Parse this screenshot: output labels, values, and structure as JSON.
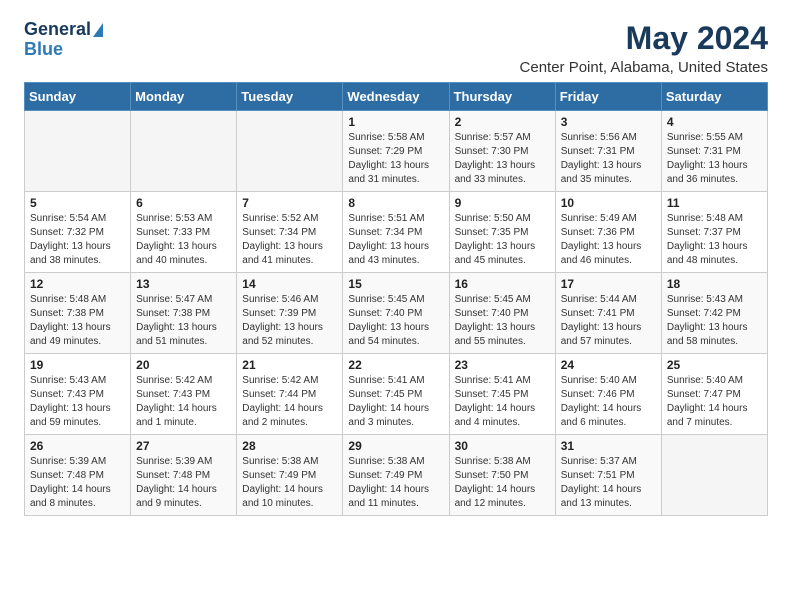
{
  "logo": {
    "general": "General",
    "blue": "Blue"
  },
  "title": "May 2024",
  "subtitle": "Center Point, Alabama, United States",
  "weekdays": [
    "Sunday",
    "Monday",
    "Tuesday",
    "Wednesday",
    "Thursday",
    "Friday",
    "Saturday"
  ],
  "weeks": [
    [
      {
        "day": "",
        "info": ""
      },
      {
        "day": "",
        "info": ""
      },
      {
        "day": "",
        "info": ""
      },
      {
        "day": "1",
        "info": "Sunrise: 5:58 AM\nSunset: 7:29 PM\nDaylight: 13 hours and 31 minutes."
      },
      {
        "day": "2",
        "info": "Sunrise: 5:57 AM\nSunset: 7:30 PM\nDaylight: 13 hours and 33 minutes."
      },
      {
        "day": "3",
        "info": "Sunrise: 5:56 AM\nSunset: 7:31 PM\nDaylight: 13 hours and 35 minutes."
      },
      {
        "day": "4",
        "info": "Sunrise: 5:55 AM\nSunset: 7:31 PM\nDaylight: 13 hours and 36 minutes."
      }
    ],
    [
      {
        "day": "5",
        "info": "Sunrise: 5:54 AM\nSunset: 7:32 PM\nDaylight: 13 hours and 38 minutes."
      },
      {
        "day": "6",
        "info": "Sunrise: 5:53 AM\nSunset: 7:33 PM\nDaylight: 13 hours and 40 minutes."
      },
      {
        "day": "7",
        "info": "Sunrise: 5:52 AM\nSunset: 7:34 PM\nDaylight: 13 hours and 41 minutes."
      },
      {
        "day": "8",
        "info": "Sunrise: 5:51 AM\nSunset: 7:34 PM\nDaylight: 13 hours and 43 minutes."
      },
      {
        "day": "9",
        "info": "Sunrise: 5:50 AM\nSunset: 7:35 PM\nDaylight: 13 hours and 45 minutes."
      },
      {
        "day": "10",
        "info": "Sunrise: 5:49 AM\nSunset: 7:36 PM\nDaylight: 13 hours and 46 minutes."
      },
      {
        "day": "11",
        "info": "Sunrise: 5:48 AM\nSunset: 7:37 PM\nDaylight: 13 hours and 48 minutes."
      }
    ],
    [
      {
        "day": "12",
        "info": "Sunrise: 5:48 AM\nSunset: 7:38 PM\nDaylight: 13 hours and 49 minutes."
      },
      {
        "day": "13",
        "info": "Sunrise: 5:47 AM\nSunset: 7:38 PM\nDaylight: 13 hours and 51 minutes."
      },
      {
        "day": "14",
        "info": "Sunrise: 5:46 AM\nSunset: 7:39 PM\nDaylight: 13 hours and 52 minutes."
      },
      {
        "day": "15",
        "info": "Sunrise: 5:45 AM\nSunset: 7:40 PM\nDaylight: 13 hours and 54 minutes."
      },
      {
        "day": "16",
        "info": "Sunrise: 5:45 AM\nSunset: 7:40 PM\nDaylight: 13 hours and 55 minutes."
      },
      {
        "day": "17",
        "info": "Sunrise: 5:44 AM\nSunset: 7:41 PM\nDaylight: 13 hours and 57 minutes."
      },
      {
        "day": "18",
        "info": "Sunrise: 5:43 AM\nSunset: 7:42 PM\nDaylight: 13 hours and 58 minutes."
      }
    ],
    [
      {
        "day": "19",
        "info": "Sunrise: 5:43 AM\nSunset: 7:43 PM\nDaylight: 13 hours and 59 minutes."
      },
      {
        "day": "20",
        "info": "Sunrise: 5:42 AM\nSunset: 7:43 PM\nDaylight: 14 hours and 1 minute."
      },
      {
        "day": "21",
        "info": "Sunrise: 5:42 AM\nSunset: 7:44 PM\nDaylight: 14 hours and 2 minutes."
      },
      {
        "day": "22",
        "info": "Sunrise: 5:41 AM\nSunset: 7:45 PM\nDaylight: 14 hours and 3 minutes."
      },
      {
        "day": "23",
        "info": "Sunrise: 5:41 AM\nSunset: 7:45 PM\nDaylight: 14 hours and 4 minutes."
      },
      {
        "day": "24",
        "info": "Sunrise: 5:40 AM\nSunset: 7:46 PM\nDaylight: 14 hours and 6 minutes."
      },
      {
        "day": "25",
        "info": "Sunrise: 5:40 AM\nSunset: 7:47 PM\nDaylight: 14 hours and 7 minutes."
      }
    ],
    [
      {
        "day": "26",
        "info": "Sunrise: 5:39 AM\nSunset: 7:48 PM\nDaylight: 14 hours and 8 minutes."
      },
      {
        "day": "27",
        "info": "Sunrise: 5:39 AM\nSunset: 7:48 PM\nDaylight: 14 hours and 9 minutes."
      },
      {
        "day": "28",
        "info": "Sunrise: 5:38 AM\nSunset: 7:49 PM\nDaylight: 14 hours and 10 minutes."
      },
      {
        "day": "29",
        "info": "Sunrise: 5:38 AM\nSunset: 7:49 PM\nDaylight: 14 hours and 11 minutes."
      },
      {
        "day": "30",
        "info": "Sunrise: 5:38 AM\nSunset: 7:50 PM\nDaylight: 14 hours and 12 minutes."
      },
      {
        "day": "31",
        "info": "Sunrise: 5:37 AM\nSunset: 7:51 PM\nDaylight: 14 hours and 13 minutes."
      },
      {
        "day": "",
        "info": ""
      }
    ]
  ]
}
